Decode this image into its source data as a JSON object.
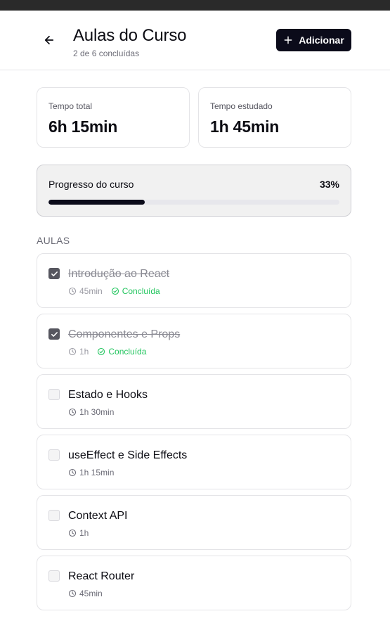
{
  "header": {
    "title": "Aulas do Curso",
    "subtitle": "2 de 6 concluídas",
    "add_label": "Adicionar"
  },
  "stats": {
    "total_label": "Tempo total",
    "total_value": "6h 15min",
    "studied_label": "Tempo estudado",
    "studied_value": "1h 45min"
  },
  "progress": {
    "label": "Progresso do curso",
    "percent_text": "33%",
    "fraction": 0.33
  },
  "section_title": "AULAS",
  "lessons": [
    {
      "title": "Introdução ao React",
      "duration": "45min",
      "done": true,
      "status": "Concluída"
    },
    {
      "title": "Componentes e Props",
      "duration": "1h",
      "done": true,
      "status": "Concluída"
    },
    {
      "title": "Estado e Hooks",
      "duration": "1h 30min",
      "done": false
    },
    {
      "title": "useEffect e Side Effects",
      "duration": "1h 15min",
      "done": false
    },
    {
      "title": "Context API",
      "duration": "1h",
      "done": false
    },
    {
      "title": "React Router",
      "duration": "45min",
      "done": false
    }
  ],
  "colors": {
    "accent": "#0b0b1a",
    "success": "#22c55e",
    "checked": "#56565f"
  },
  "icons": {
    "back": "arrow-left-icon",
    "add": "plus-icon",
    "duration": "clock-icon",
    "status": "check-circle-icon",
    "checkbox": "check-icon"
  }
}
